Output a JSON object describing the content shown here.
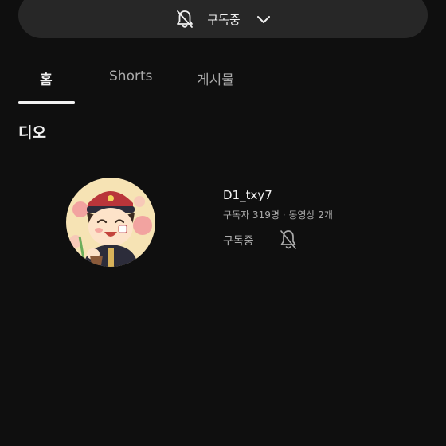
{
  "subscribe_bar": {
    "bell_icon": "bell-off-icon",
    "label": "구독중",
    "chevron_icon": "chevron-down-icon"
  },
  "tabs": [
    {
      "label": "홈",
      "active": true
    },
    {
      "label": "Shorts",
      "active": false
    },
    {
      "label": "게시물",
      "active": false
    }
  ],
  "section_title": "디오",
  "channel": {
    "name": "D1_txy7",
    "meta": "구독자 319명 · 동영상 2개",
    "subscribed_label": "구독중",
    "bell_icon": "bell-off-icon"
  },
  "colors": {
    "background": "#0f0f0f",
    "pill": "#272727",
    "text": "#f1f1f1",
    "muted": "#aaaaaa"
  }
}
